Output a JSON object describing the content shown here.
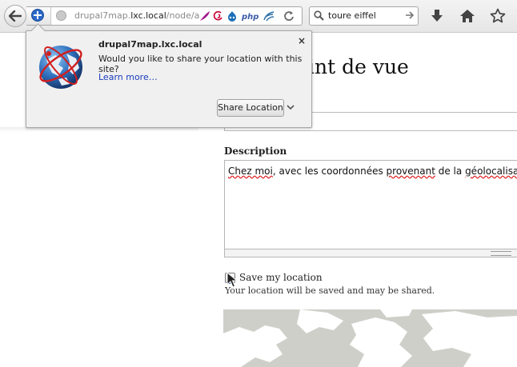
{
  "toolbar": {
    "url_prefix": "drupal7map.",
    "url_host": "lxc.local",
    "url_path": "/node/a",
    "search_value": "toure eiffel",
    "php_badge": "php"
  },
  "panel": {
    "host": "drupal7map.lxc.local",
    "question": "Would you like to share your location with this site?",
    "learn_more": "Learn more…",
    "close": "×",
    "share_button": "Share Location"
  },
  "page": {
    "title_fragment": "int de vue",
    "description_label": "Description",
    "description_value_parts": [
      "Chez moi",
      ", avec les coordonnées ",
      "provenant",
      " de la ",
      "géolocalisat"
    ],
    "save_label": "Save my location",
    "save_checked": true,
    "save_description": "Your location will be saved and may be shared."
  }
}
